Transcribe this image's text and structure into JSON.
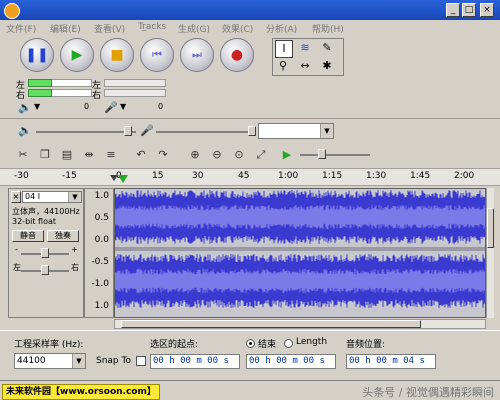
{
  "menu": {
    "items": [
      "文件(F)",
      "编辑(E)",
      "查看(V)",
      "Tr̲acks",
      "生成(G)",
      "效果(C)",
      "分析(A)",
      "帮助(H)"
    ]
  },
  "meters": {
    "left_channel": "左",
    "right_channel": "右",
    "play_level": 0.38,
    "record_level": 0.0,
    "scale_marks": [
      "0",
      "0"
    ]
  },
  "timeline": {
    "labels": [
      "-30",
      "-15",
      "0",
      "15",
      "30",
      "45",
      "1:00",
      "1:15",
      "1:30",
      "1:45",
      "2:00"
    ]
  },
  "track": {
    "name": "04 I",
    "info_line1": "立体声，44100Hz",
    "info_line2": "32-bit float",
    "mute_label": "静音",
    "solo_label": "独奏",
    "gain_min": "-",
    "gain_max": "+",
    "pan_left": "左",
    "pan_right": "右",
    "scale_top": [
      "1.0",
      "0.5",
      "0.0",
      "-0.5",
      "-1.0"
    ],
    "scale_bottom": [
      "1.0"
    ],
    "wave_color": "#3a3ad0"
  },
  "bottom": {
    "project_rate_label": "工程采样率 (Hz):",
    "project_rate_value": "44100",
    "snap_label": "Snap To",
    "selection_start_label": "选区的起点:",
    "end_radio_label": "结束",
    "length_radio_label": "Length",
    "audio_position_label": "音频位置:",
    "selection_start_value": "00 h 00 m 00 s",
    "selection_end_value": "00 h 00 m 00 s",
    "audio_position_value": "00 h 00 m 04 s"
  },
  "status": {
    "brand": "未来软件园【www.orsoon.com】",
    "watermark": "头条号 / 视觉偶遇精彩瞬间"
  },
  "colors": {
    "title_bar": "#2b62d8",
    "meter_green": "#5fe05f",
    "wave_blue": "#3a3ad0",
    "brand_bg": "#ffea3a"
  }
}
